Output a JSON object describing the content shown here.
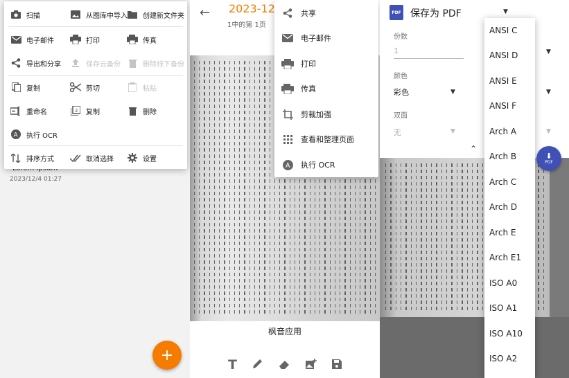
{
  "panel1": {
    "menu": {
      "scan": "扫描",
      "import_gallery": "从图库中导入",
      "new_folder": "创建新文件夹",
      "email": "电子邮件",
      "print": "打印",
      "fax": "传真",
      "export_share": "导出和分享",
      "save_cloud": "保存云备份",
      "delete_offline": "删除线下备份",
      "copy": "复制",
      "cut": "剪切",
      "paste": "粘贴",
      "rename": "重命名",
      "duplicate": "复制",
      "delete": "删除",
      "ocr": "执行 OCR",
      "sort": "排序方式",
      "deselect": "取消选择",
      "settings": "设置"
    },
    "doc_title": "Lorem Ipsum",
    "doc_date": "2023/12/4 01:27",
    "fab": "+"
  },
  "panel2": {
    "date": "2023-12-",
    "page_info": "1中的第 1页",
    "app_name": "枫音应用",
    "share_menu": {
      "share": "共享",
      "email": "电子邮件",
      "print": "打印",
      "fax": "传真",
      "crop": "剪裁加强",
      "view_pages": "查看和整理页面",
      "ocr": "执行 OCR"
    }
  },
  "panel3": {
    "title": "保存为 PDF",
    "copies_label": "份数",
    "copies_value": "1",
    "color_label": "颜色",
    "color_value": "彩色",
    "duplex_label": "双面",
    "duplex_value": "无",
    "paper_sizes": [
      "ANSI C",
      "ANSI D",
      "ANSI E",
      "ANSI F",
      "Arch A",
      "Arch B",
      "Arch C",
      "Arch D",
      "Arch E",
      "Arch E1",
      "ISO A0",
      "ISO A1",
      "ISO A10",
      "ISO A2"
    ],
    "fab_text": "PDF",
    "pdf_icon_text": "PDF"
  },
  "colors": {
    "accent": "#f57c00",
    "pdf_blue": "#3f51b5"
  }
}
